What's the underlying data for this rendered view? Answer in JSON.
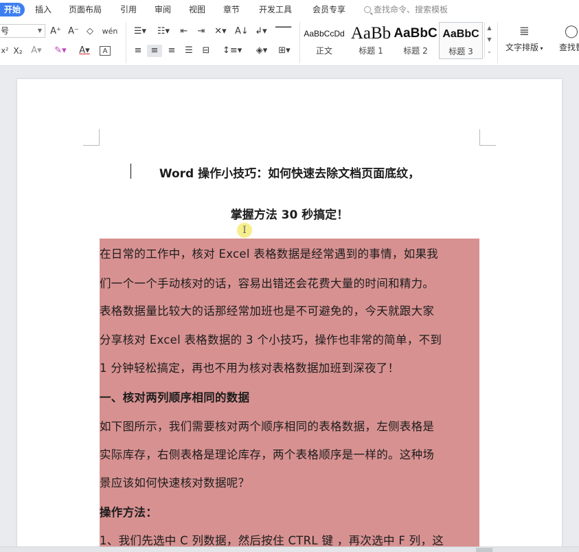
{
  "menu": {
    "tabs": [
      {
        "label": "开始",
        "active": true
      },
      {
        "label": "插入"
      },
      {
        "label": "页面布局"
      },
      {
        "label": "引用"
      },
      {
        "label": "审阅"
      },
      {
        "label": "视图"
      },
      {
        "label": "章节"
      },
      {
        "label": "开发工具"
      },
      {
        "label": "会员专享"
      }
    ],
    "search_placeholder": "查找命令、搜索模板"
  },
  "ribbon": {
    "font_size_value": "号",
    "styles": [
      {
        "sample": "AaBbCcDd",
        "label": "正文"
      },
      {
        "sample": "AaBb",
        "label": "标题 1"
      },
      {
        "sample": "AaBbC",
        "label": "标题 2"
      },
      {
        "sample": "AaBbC",
        "label": "标题 3",
        "selected": true
      }
    ],
    "text_layout_label": "文字排版",
    "find_label": "查找替"
  },
  "document": {
    "title_line1": "Word 操作小技巧：如何快速去除文档页面底纹，",
    "title_line2": "掌握方法 30 秒搞定！",
    "shading_color": "#d89191",
    "paragraphs": [
      "在日常的工作中，核对 Excel 表格数据是经常遇到的事情，如果我",
      "们一个一个手动核对的话，容易出错还会花费大量的时间和精力。",
      "表格数据量比较大的话那经常加班也是不可避免的，今天就跟大家",
      "分享核对 Excel 表格数据的 3 个小技巧，操作也非常的简单，不到",
      "1 分钟轻松搞定，再也不用为核对表格数据加班到深夜了！",
      "一、核对两列顺序相同的数据",
      "如下图所示，我们需要核对两个顺序相同的表格数据，左侧表格是",
      "实际库存，右侧表格是理论库存，两个表格顺序是一样的。这种场",
      "景应该如何快速核对数据呢？",
      "操作方法：",
      "1、我们先选中 C 列数据，然后按住 CTRL 键 ，再次选中 F 列，这"
    ]
  },
  "colors": {
    "accent": "#3d7ff1",
    "shading": "#d89191"
  }
}
